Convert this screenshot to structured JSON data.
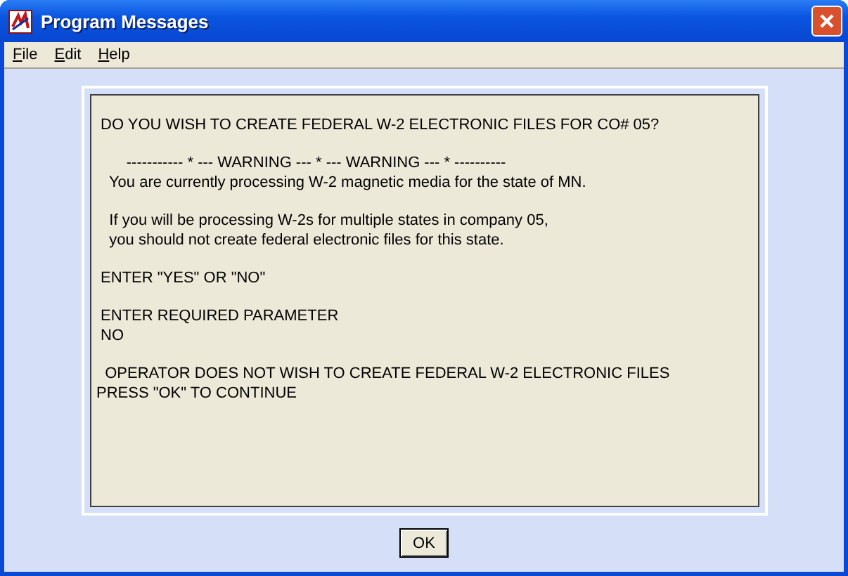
{
  "window": {
    "title": "Program Messages"
  },
  "menu": [
    {
      "label": "File"
    },
    {
      "label": "Edit"
    },
    {
      "label": "Help"
    }
  ],
  "message": [
    [
      " DO YOU WISH TO CREATE FEDERAL W-2 ELECTRONIC FILES FOR CO# 05?"
    ],
    [
      "       ----------- * --- WARNING --- * --- WARNING --- * ----------",
      "   You are currently processing W-2 magnetic media for the state of MN."
    ],
    [
      "   If you will be processing W-2s for multiple states in company 05,",
      "   you should not create federal electronic files for this state."
    ],
    [
      " ENTER \"YES\" OR \"NO\""
    ],
    [
      " ENTER REQUIRED PARAMETER",
      " NO"
    ],
    [
      "  OPERATOR DOES NOT WISH TO CREATE FEDERAL W-2 ELECTRONIC FILES",
      "PRESS \"OK\" TO CONTINUE"
    ]
  ],
  "buttons": [
    "OK"
  ]
}
